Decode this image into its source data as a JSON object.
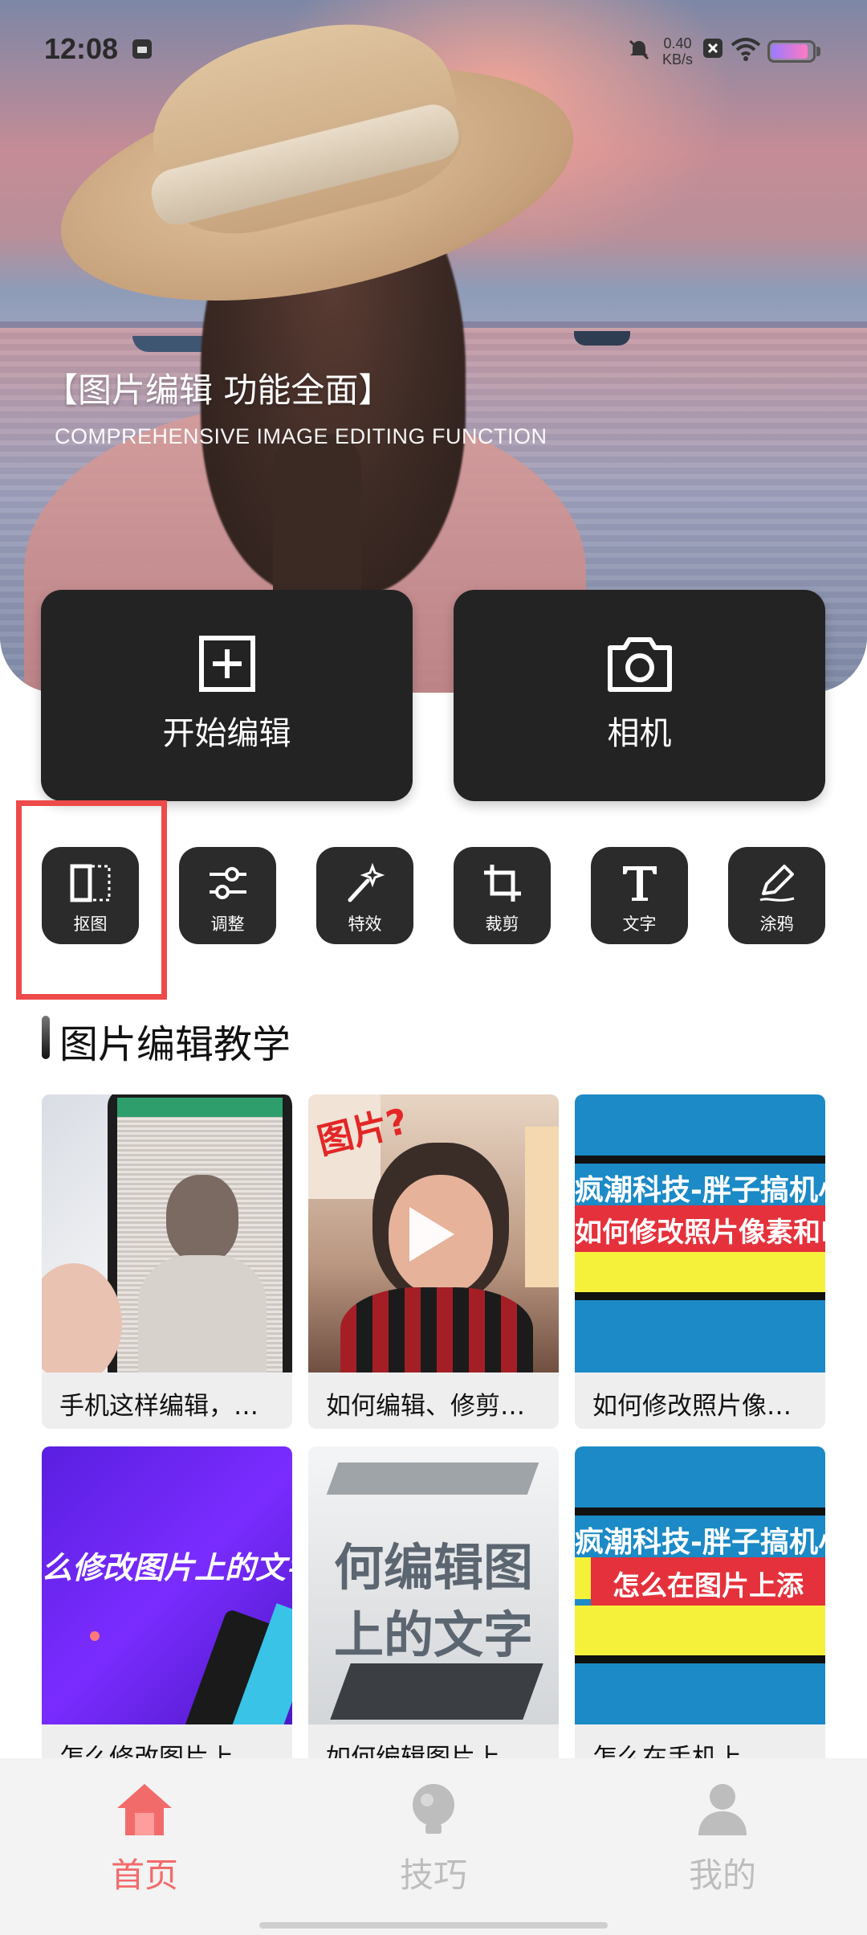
{
  "status_bar": {
    "time": "12:08",
    "net_speed_value": "0.40",
    "net_speed_unit": "KB/s",
    "battery_level": 0.9
  },
  "hero": {
    "title": "【图片编辑 功能全面】",
    "subtitle": "COMPREHENSIVE IMAGE EDITING FUNCTION"
  },
  "actions": {
    "start_edit_label": "开始编辑",
    "camera_label": "相机"
  },
  "tools": [
    {
      "label": "抠图",
      "icon": "cutout-icon"
    },
    {
      "label": "调整",
      "icon": "sliders-icon"
    },
    {
      "label": "特效",
      "icon": "magic-wand-icon"
    },
    {
      "label": "裁剪",
      "icon": "crop-icon"
    },
    {
      "label": "文字",
      "icon": "text-icon"
    },
    {
      "label": "涂鸦",
      "icon": "pencil-icon"
    }
  ],
  "section": {
    "title": "图片编辑教学"
  },
  "videos": [
    {
      "caption": "手机这样编辑，…",
      "thumb_text": ""
    },
    {
      "caption": "如何编辑、修剪…",
      "thumb_text": ""
    },
    {
      "caption": "如何修改照片像…",
      "thumb_text_1": "疯潮科技-胖子搞机小",
      "thumb_text_2": "如何修改照片像素和R"
    },
    {
      "caption": "怎么修改图片上…",
      "thumb_text": "么修改图片上的文字"
    },
    {
      "caption": "如何编辑图片上…",
      "thumb_text_1": "何编辑图",
      "thumb_text_2": "上的文字"
    },
    {
      "caption": "怎么在手机上…",
      "thumb_text_1": "疯潮科技-胖子搞机小",
      "thumb_text_2": "怎么在图片上添"
    }
  ],
  "bottom_nav": {
    "items": [
      {
        "label": "首页",
        "icon": "home-icon",
        "active": true
      },
      {
        "label": "技巧",
        "icon": "lightbulb-icon",
        "active": false
      },
      {
        "label": "我的",
        "icon": "user-icon",
        "active": false
      }
    ],
    "active_color": "#f26b6b",
    "inactive_color": "#bdbdbd"
  }
}
